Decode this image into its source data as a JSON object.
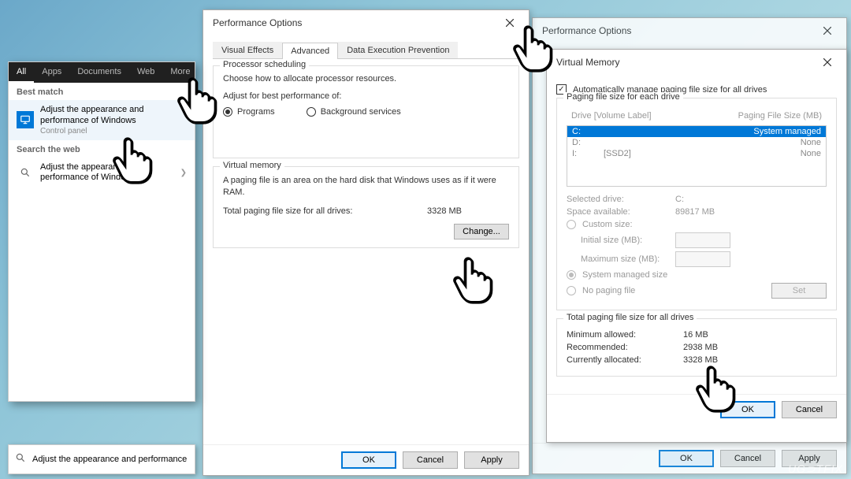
{
  "search": {
    "tabs": [
      "All",
      "Apps",
      "Documents",
      "Web",
      "More"
    ],
    "best_match_h": "Best match",
    "best_match": {
      "line1": "Adjust the appearance and",
      "line2": "performance of Windows",
      "sub": "Control panel"
    },
    "web_h": "Search the web",
    "web_item": {
      "line1": "Adjust the appearance and",
      "line2": "performance of Windows"
    },
    "input_value": "Adjust the appearance and performance of Windows"
  },
  "perf_bg": {
    "title": "Performance Options",
    "tabs": [
      "Visual Effects",
      "Advanced",
      "Data Execution Prevention"
    ],
    "ok": "OK",
    "cancel": "Cancel",
    "apply": "Apply"
  },
  "perf": {
    "title": "Performance Options",
    "tabs": [
      "Visual Effects",
      "Advanced",
      "Data Execution Prevention"
    ],
    "sched": {
      "title": "Processor scheduling",
      "sub": "Choose how to allocate processor resources.",
      "adjust": "Adjust for best performance of:",
      "programs": "Programs",
      "bg": "Background services"
    },
    "vm": {
      "title": "Virtual memory",
      "desc": "A paging file is an area on the hard disk that Windows uses as if it were RAM.",
      "total_label": "Total paging file size for all drives:",
      "total_value": "3328 MB",
      "change": "Change..."
    },
    "ok": "OK",
    "cancel": "Cancel",
    "apply": "Apply"
  },
  "vmem": {
    "title": "Virtual Memory",
    "auto": "Automatically manage paging file size for all drives",
    "drive_group": "Paging file size for each drive",
    "head_drive": "Drive  [Volume Label]",
    "head_size": "Paging File Size (MB)",
    "drives": [
      {
        "letter": "C:",
        "label": "",
        "size": "System managed",
        "selected": true
      },
      {
        "letter": "D:",
        "label": "",
        "size": "None",
        "selected": false
      },
      {
        "letter": "I:",
        "label": "[SSD2]",
        "size": "None",
        "selected": false
      }
    ],
    "sel_drive_l": "Selected drive:",
    "sel_drive_v": "C:",
    "space_l": "Space available:",
    "space_v": "89817 MB",
    "custom": "Custom size:",
    "init": "Initial size (MB):",
    "max": "Maximum size (MB):",
    "sys_managed": "System managed size",
    "no_paging": "No paging file",
    "set": "Set",
    "totals_h": "Total paging file size for all drives",
    "min_l": "Minimum allowed:",
    "min_v": "16 MB",
    "rec_l": "Recommended:",
    "rec_v": "2938 MB",
    "cur_l": "Currently allocated:",
    "cur_v": "3328 MB",
    "ok": "OK",
    "cancel": "Cancel"
  },
  "watermark": "UG⊃TFIX"
}
